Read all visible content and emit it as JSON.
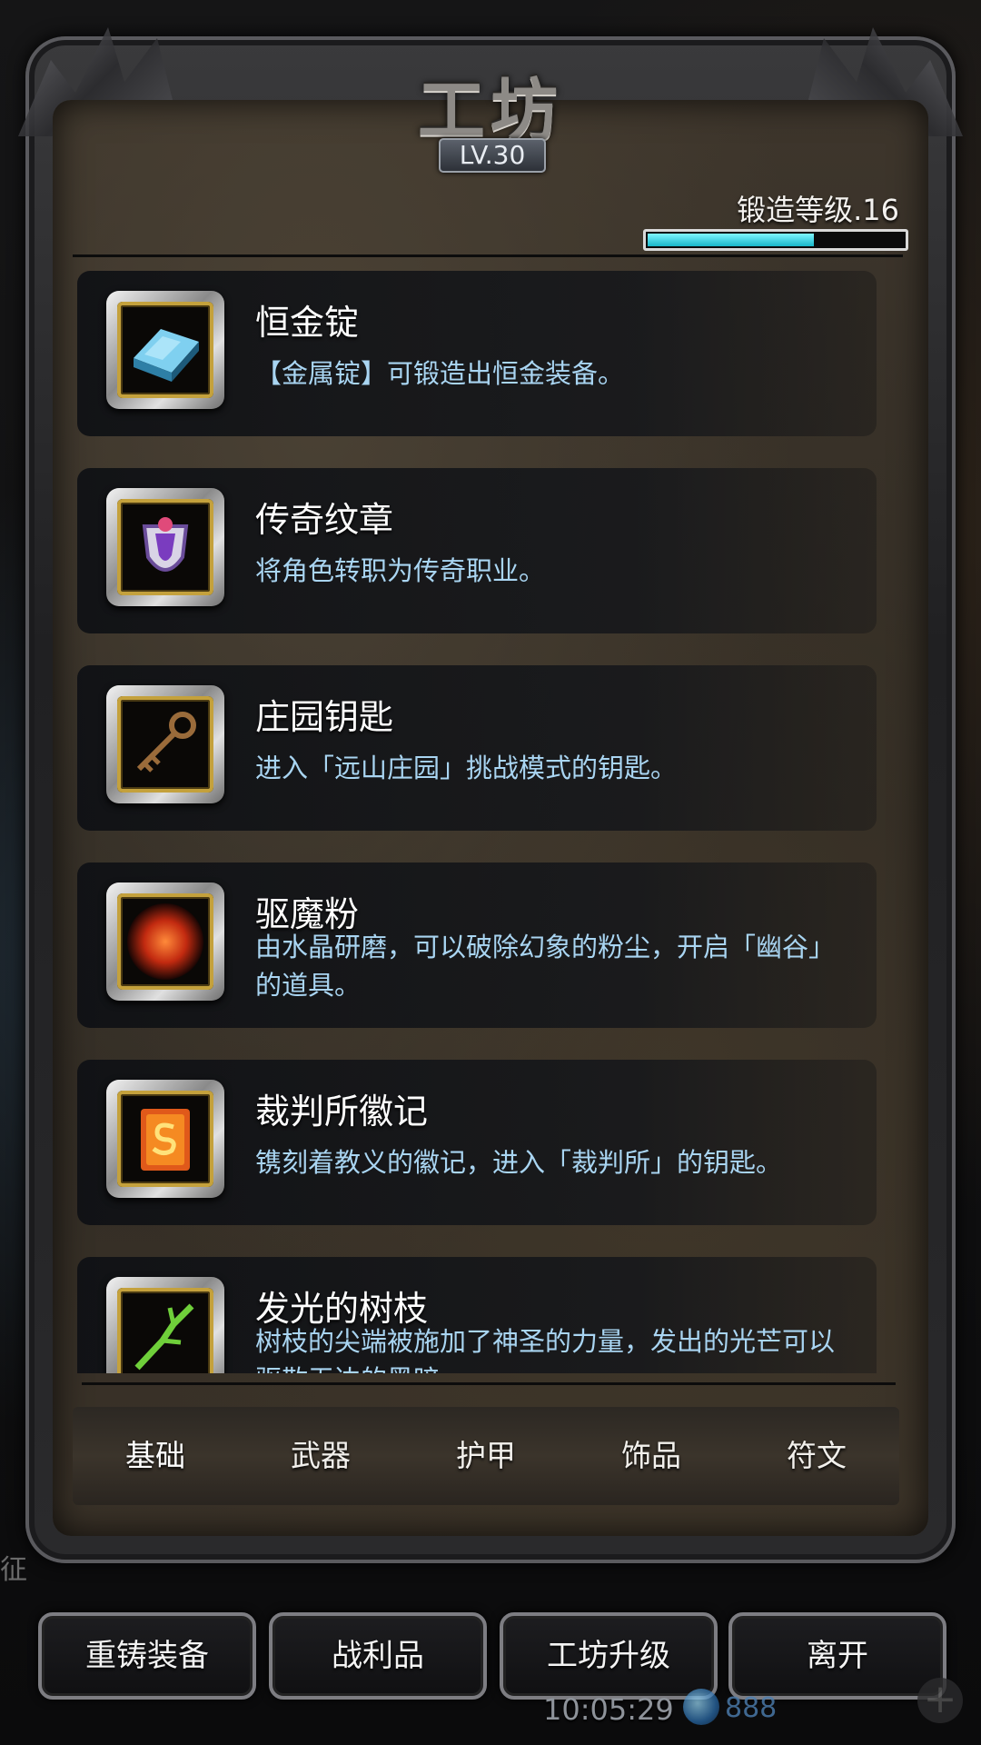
{
  "panel": {
    "title": "工坊",
    "level_badge": "LV.30",
    "forge_level_label": "锻造等级.16",
    "forge_progress": 0.65
  },
  "items": [
    {
      "name": "恒金锭",
      "description": "【金属锭】可锻造出恒金装备。",
      "icon": "ingot-icon"
    },
    {
      "name": "传奇纹章",
      "description": "将角色转职为传奇职业。",
      "icon": "emblem-icon"
    },
    {
      "name": "庄园钥匙",
      "description": "进入「远山庄园」挑战模式的钥匙。",
      "icon": "key-icon"
    },
    {
      "name": "驱魔粉",
      "description": "由水晶研磨，可以破除幻象的粉尘，开启「幽谷」的道具。",
      "icon": "exorcism-powder-icon"
    },
    {
      "name": "裁判所徽记",
      "description": "镌刻着教义的徽记，进入「裁判所」的钥匙。",
      "icon": "tribunal-seal-icon"
    },
    {
      "name": "发光的树枝",
      "description": "树枝的尖端被施加了神圣的力量，发出的光芒可以驱散无边的黑暗。",
      "icon": "glowing-branch-icon"
    }
  ],
  "tabs": [
    "基础",
    "武器",
    "护甲",
    "饰品",
    "符文"
  ],
  "buttons": [
    "重铸装备",
    "战利品",
    "工坊升级",
    "离开"
  ],
  "status": {
    "clock": "10:05:29",
    "gems": "888",
    "side_text": "征"
  },
  "colors": {
    "desc_text": "#a9d5f2",
    "progress_fill": "#18b6c9",
    "icon_border_gold": "#c4a13c"
  }
}
